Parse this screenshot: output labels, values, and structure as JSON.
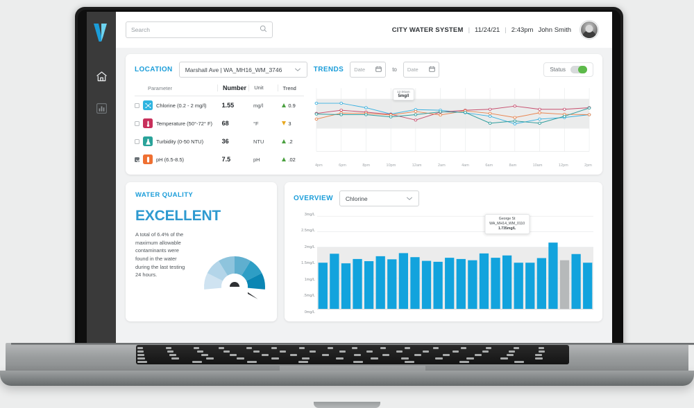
{
  "sidebar": {
    "logo_icon": "v-logo-icon",
    "items": [
      {
        "icon": "home-icon",
        "name": "home",
        "active": true
      },
      {
        "icon": "bar-chart-icon",
        "name": "analytics",
        "active": false
      }
    ]
  },
  "topbar": {
    "search": {
      "value": "",
      "placeholder": "Search",
      "icon": "search-icon"
    },
    "system_name": "CITY WATER SYSTEM",
    "separator": "|",
    "date": "11/24/21",
    "time": "2:43pm",
    "user_name": "John Smith",
    "avatar_icon": "avatar"
  },
  "controls": {
    "location_label": "LOCATION",
    "location_value": "Marshall Ave | WA_MH16_WM_3746",
    "trends_label": "TRENDS",
    "date_from_placeholder": "Date",
    "date_to_placeholder": "Date",
    "to_label": "to",
    "calendar_icon": "calendar-icon",
    "chevron_icon": "chevron-down-icon",
    "status_label": "Status",
    "status_on": true,
    "toggle_color": "#5dba4a",
    "accent_color": "#1b9dd9"
  },
  "parameters_table": {
    "columns": [
      "Parameter",
      "Number",
      "Unit",
      "Trend"
    ],
    "rows": [
      {
        "checked": false,
        "icon": "chlorine-molecule-icon",
        "icon_color": "#2fb4e0",
        "name": "Chlorine (0.2 - 2 mg/l)",
        "number": "1.55",
        "unit": "mg/l",
        "trend_dir": "up",
        "trend_value": "0.9"
      },
      {
        "checked": false,
        "icon": "thermometer-icon",
        "icon_color": "#c8305b",
        "name": "Temperature (50°-72° F)",
        "number": "68",
        "unit": "°F",
        "trend_dir": "down",
        "trend_value": "3"
      },
      {
        "checked": false,
        "icon": "flask-icon",
        "icon_color": "#2aa39a",
        "name": "Turbidity (0-50 NTU)",
        "number": "36",
        "unit": "NTU",
        "trend_dir": "up",
        "trend_value": ".2"
      },
      {
        "checked": true,
        "icon": "ph-vial-icon",
        "icon_color": "#ef7032",
        "name": "pH (6.5-8.5)",
        "number": "7.5",
        "unit": "pH",
        "trend_dir": "up",
        "trend_value": ".02"
      }
    ]
  },
  "water_quality": {
    "title": "WATER QUALITY",
    "status": "EXCELLENT",
    "status_color": "#2e9ad0",
    "description": "A total of 6.4% of the maximum allowable contaminants were found in the water during the last testing 24 hours.",
    "gauge_icon": "gauge-icon",
    "gauge_value_percent": 6.4,
    "gauge_segment_colors": [
      "#cfe3f1",
      "#b3d5e9",
      "#8ec4dd",
      "#5fafcf",
      "#2e9ec5",
      "#0b86b4"
    ]
  },
  "overview": {
    "title": "OVERVIEW",
    "selected_parameter": "Chlorine",
    "chevron_icon": "chevron-down-icon",
    "tooltip": {
      "line1": "George St",
      "line2": "WA_MH14_WM_0110",
      "line3": "1.735mg/L"
    }
  },
  "chart_data": [
    {
      "type": "line",
      "title": "",
      "xlabel": "",
      "ylabel": "",
      "grid": true,
      "legend": "none",
      "categories": [
        "4pm",
        "6pm",
        "8pm",
        "10pm",
        "12am",
        "2am",
        "4am",
        "6am",
        "8am",
        "10am",
        "12pm",
        "2pm"
      ],
      "ylim": [
        0,
        10
      ],
      "annotation": {
        "label": "12:00am",
        "value": "5mg/l",
        "at_category": "12am",
        "series": "Chlorine"
      },
      "series": [
        {
          "name": "Chlorine",
          "color": "#39b0df",
          "values": [
            7.6,
            7.6,
            6.9,
            5.9,
            6.6,
            6.5,
            6.1,
            5.55,
            4.35,
            5.1,
            5.35,
            5.8,
            5.8
          ]
        },
        {
          "name": "Temperature",
          "color": "#c74e6e",
          "values": [
            6.0,
            6.5,
            6.2,
            5.85,
            4.95,
            6.2,
            6.5,
            6.65,
            7.15,
            6.65,
            6.65,
            6.9
          ]
        },
        {
          "name": "Turbidity",
          "color": "#e8834e",
          "values": [
            5.1,
            6.05,
            6.0,
            5.75,
            6.3,
            5.75,
            6.4,
            6.0,
            5.35,
            6.1,
            5.85,
            5.8
          ]
        },
        {
          "name": "pH",
          "color": "#2d9c9c",
          "values": [
            5.9,
            5.8,
            5.8,
            5.45,
            5.8,
            6.25,
            6.15,
            4.45,
            4.8,
            4.45,
            5.55,
            6.85
          ]
        }
      ]
    },
    {
      "type": "bar",
      "title": "",
      "xlabel": "",
      "ylabel": "mg/L",
      "grid": true,
      "legend": "none",
      "yticks": [
        "3mg/L",
        "2.5mg/L",
        "2mg/L",
        "1.5mg/L",
        "1mg/L",
        ".5mg/L",
        "0mg/L"
      ],
      "ylim": [
        0,
        3
      ],
      "bar_color": "#12a3dd",
      "highlight_color": "#b6b9ba",
      "highlight_index": 21,
      "values": [
        1.5,
        1.79,
        1.48,
        1.62,
        1.55,
        1.71,
        1.61,
        1.81,
        1.68,
        1.56,
        1.53,
        1.66,
        1.62,
        1.58,
        1.8,
        1.66,
        1.735,
        1.5,
        1.5,
        1.65,
        2.15,
        1.58,
        1.78,
        1.5
      ]
    }
  ]
}
